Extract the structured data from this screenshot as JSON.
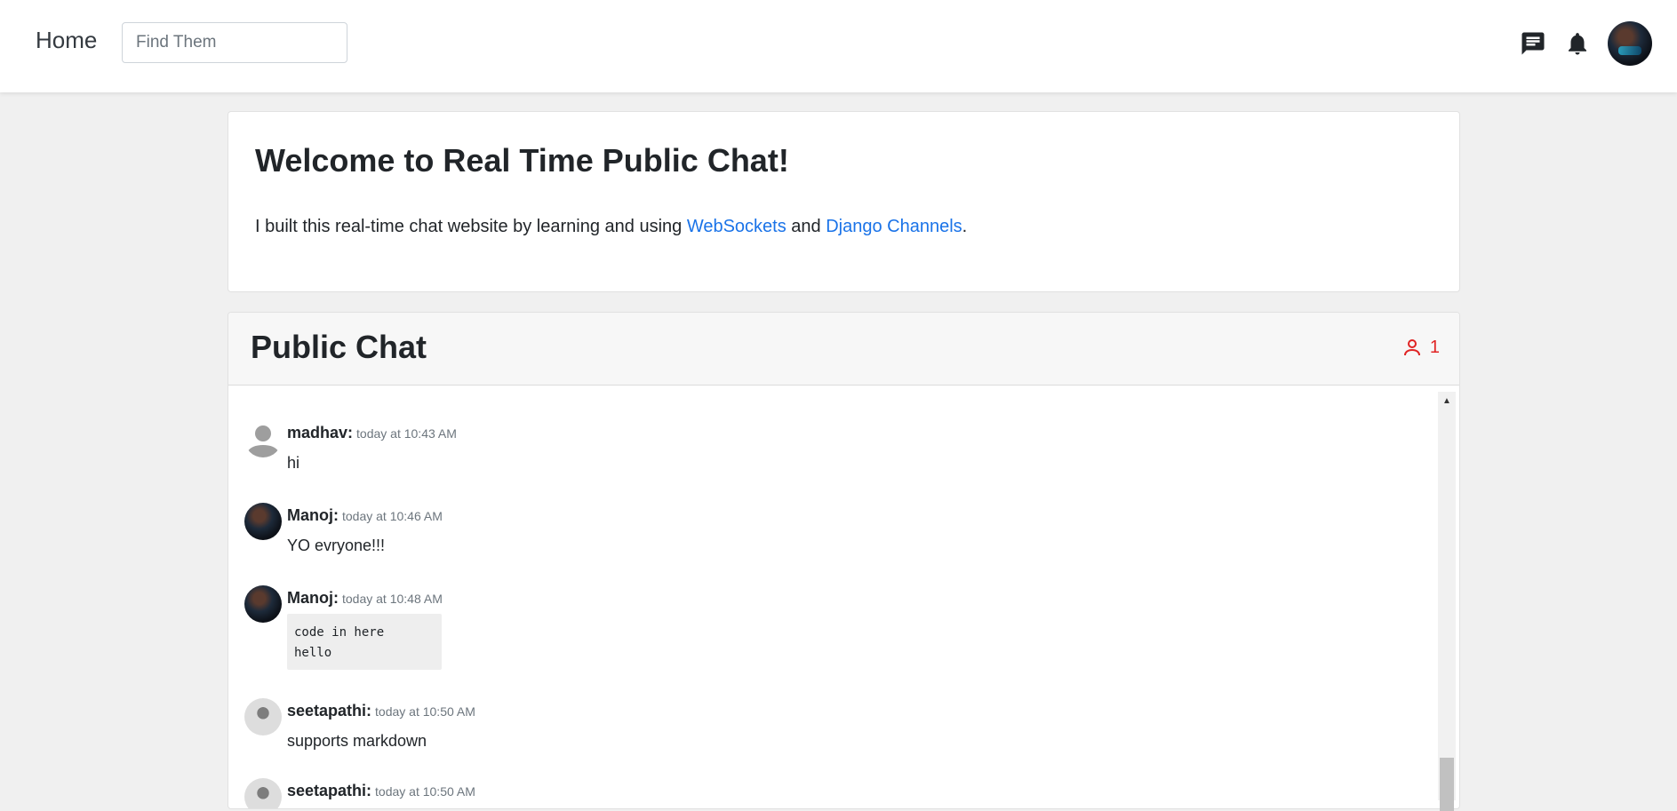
{
  "nav": {
    "home_label": "Home",
    "search_placeholder": "Find Them",
    "icons": [
      "chat-icon",
      "bell-icon",
      "avatar"
    ]
  },
  "welcome": {
    "title": "Welcome to Real Time Public Chat!",
    "text_before": "I built this real-time chat website by learning and using ",
    "link1": "WebSockets",
    "text_middle": " and ",
    "link2": "Django Channels",
    "text_after": "."
  },
  "chat": {
    "title": "Public Chat",
    "online_count": "1",
    "messages": [
      {
        "user": "madhav:",
        "time": "today at 10:43 AM",
        "body": "hi",
        "avatar": "default-avatar-icon"
      },
      {
        "user": "Manoj:",
        "time": "today at 10:46 AM",
        "body": "YO evryone!!!",
        "avatar": "manoj-avatar"
      },
      {
        "user": "Manoj:",
        "time": "today at 10:48 AM",
        "code_lines": [
          "code in here",
          "hello"
        ],
        "avatar": "manoj-avatar"
      },
      {
        "user": "seetapathi:",
        "time": "today at 10:50 AM",
        "body": "supports markdown",
        "avatar": "seetapathi-avatar"
      },
      {
        "user": "seetapathi:",
        "time": "today at 10:50 AM",
        "body": "",
        "avatar": "seetapathi-avatar"
      }
    ]
  },
  "colors": {
    "link": "#1a73e8",
    "online": "#e02424",
    "background": "#f0f0f0"
  }
}
